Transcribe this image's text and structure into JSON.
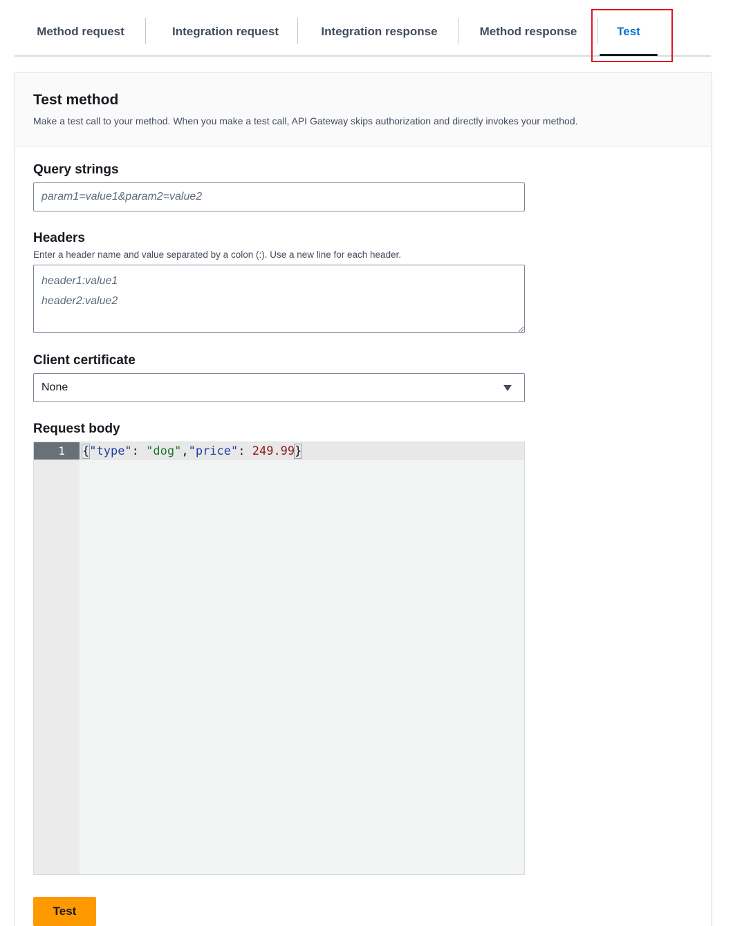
{
  "tabs": [
    {
      "label": "Method request",
      "active": false
    },
    {
      "label": "Integration request",
      "active": false
    },
    {
      "label": "Integration response",
      "active": false
    },
    {
      "label": "Method response",
      "active": false
    },
    {
      "label": "Test",
      "active": true
    }
  ],
  "panel": {
    "title": "Test method",
    "description": "Make a test call to your method. When you make a test call, API Gateway skips authorization and directly invokes your method."
  },
  "query_strings": {
    "label": "Query strings",
    "placeholder": "param1=value1&param2=value2",
    "value": ""
  },
  "headers": {
    "label": "Headers",
    "help": "Enter a header name and value separated by a colon (:). Use a new line for each header.",
    "placeholder": "header1:value1\nheader2:value2",
    "value": ""
  },
  "client_certificate": {
    "label": "Client certificate",
    "selected": "None"
  },
  "request_body": {
    "label": "Request body",
    "line_number": "1",
    "tokens": {
      "open_brace": "{",
      "key1": "\"type\"",
      "colon1": ": ",
      "val1": "\"dog\"",
      "comma": ",",
      "key2": "\"price\"",
      "colon2": ": ",
      "val2": "249.99",
      "close_brace": "}"
    }
  },
  "actions": {
    "test_label": "Test"
  },
  "colors": {
    "accent": "#0972d3",
    "primary_button": "#ff9900",
    "highlight_box": "#e0141e"
  }
}
